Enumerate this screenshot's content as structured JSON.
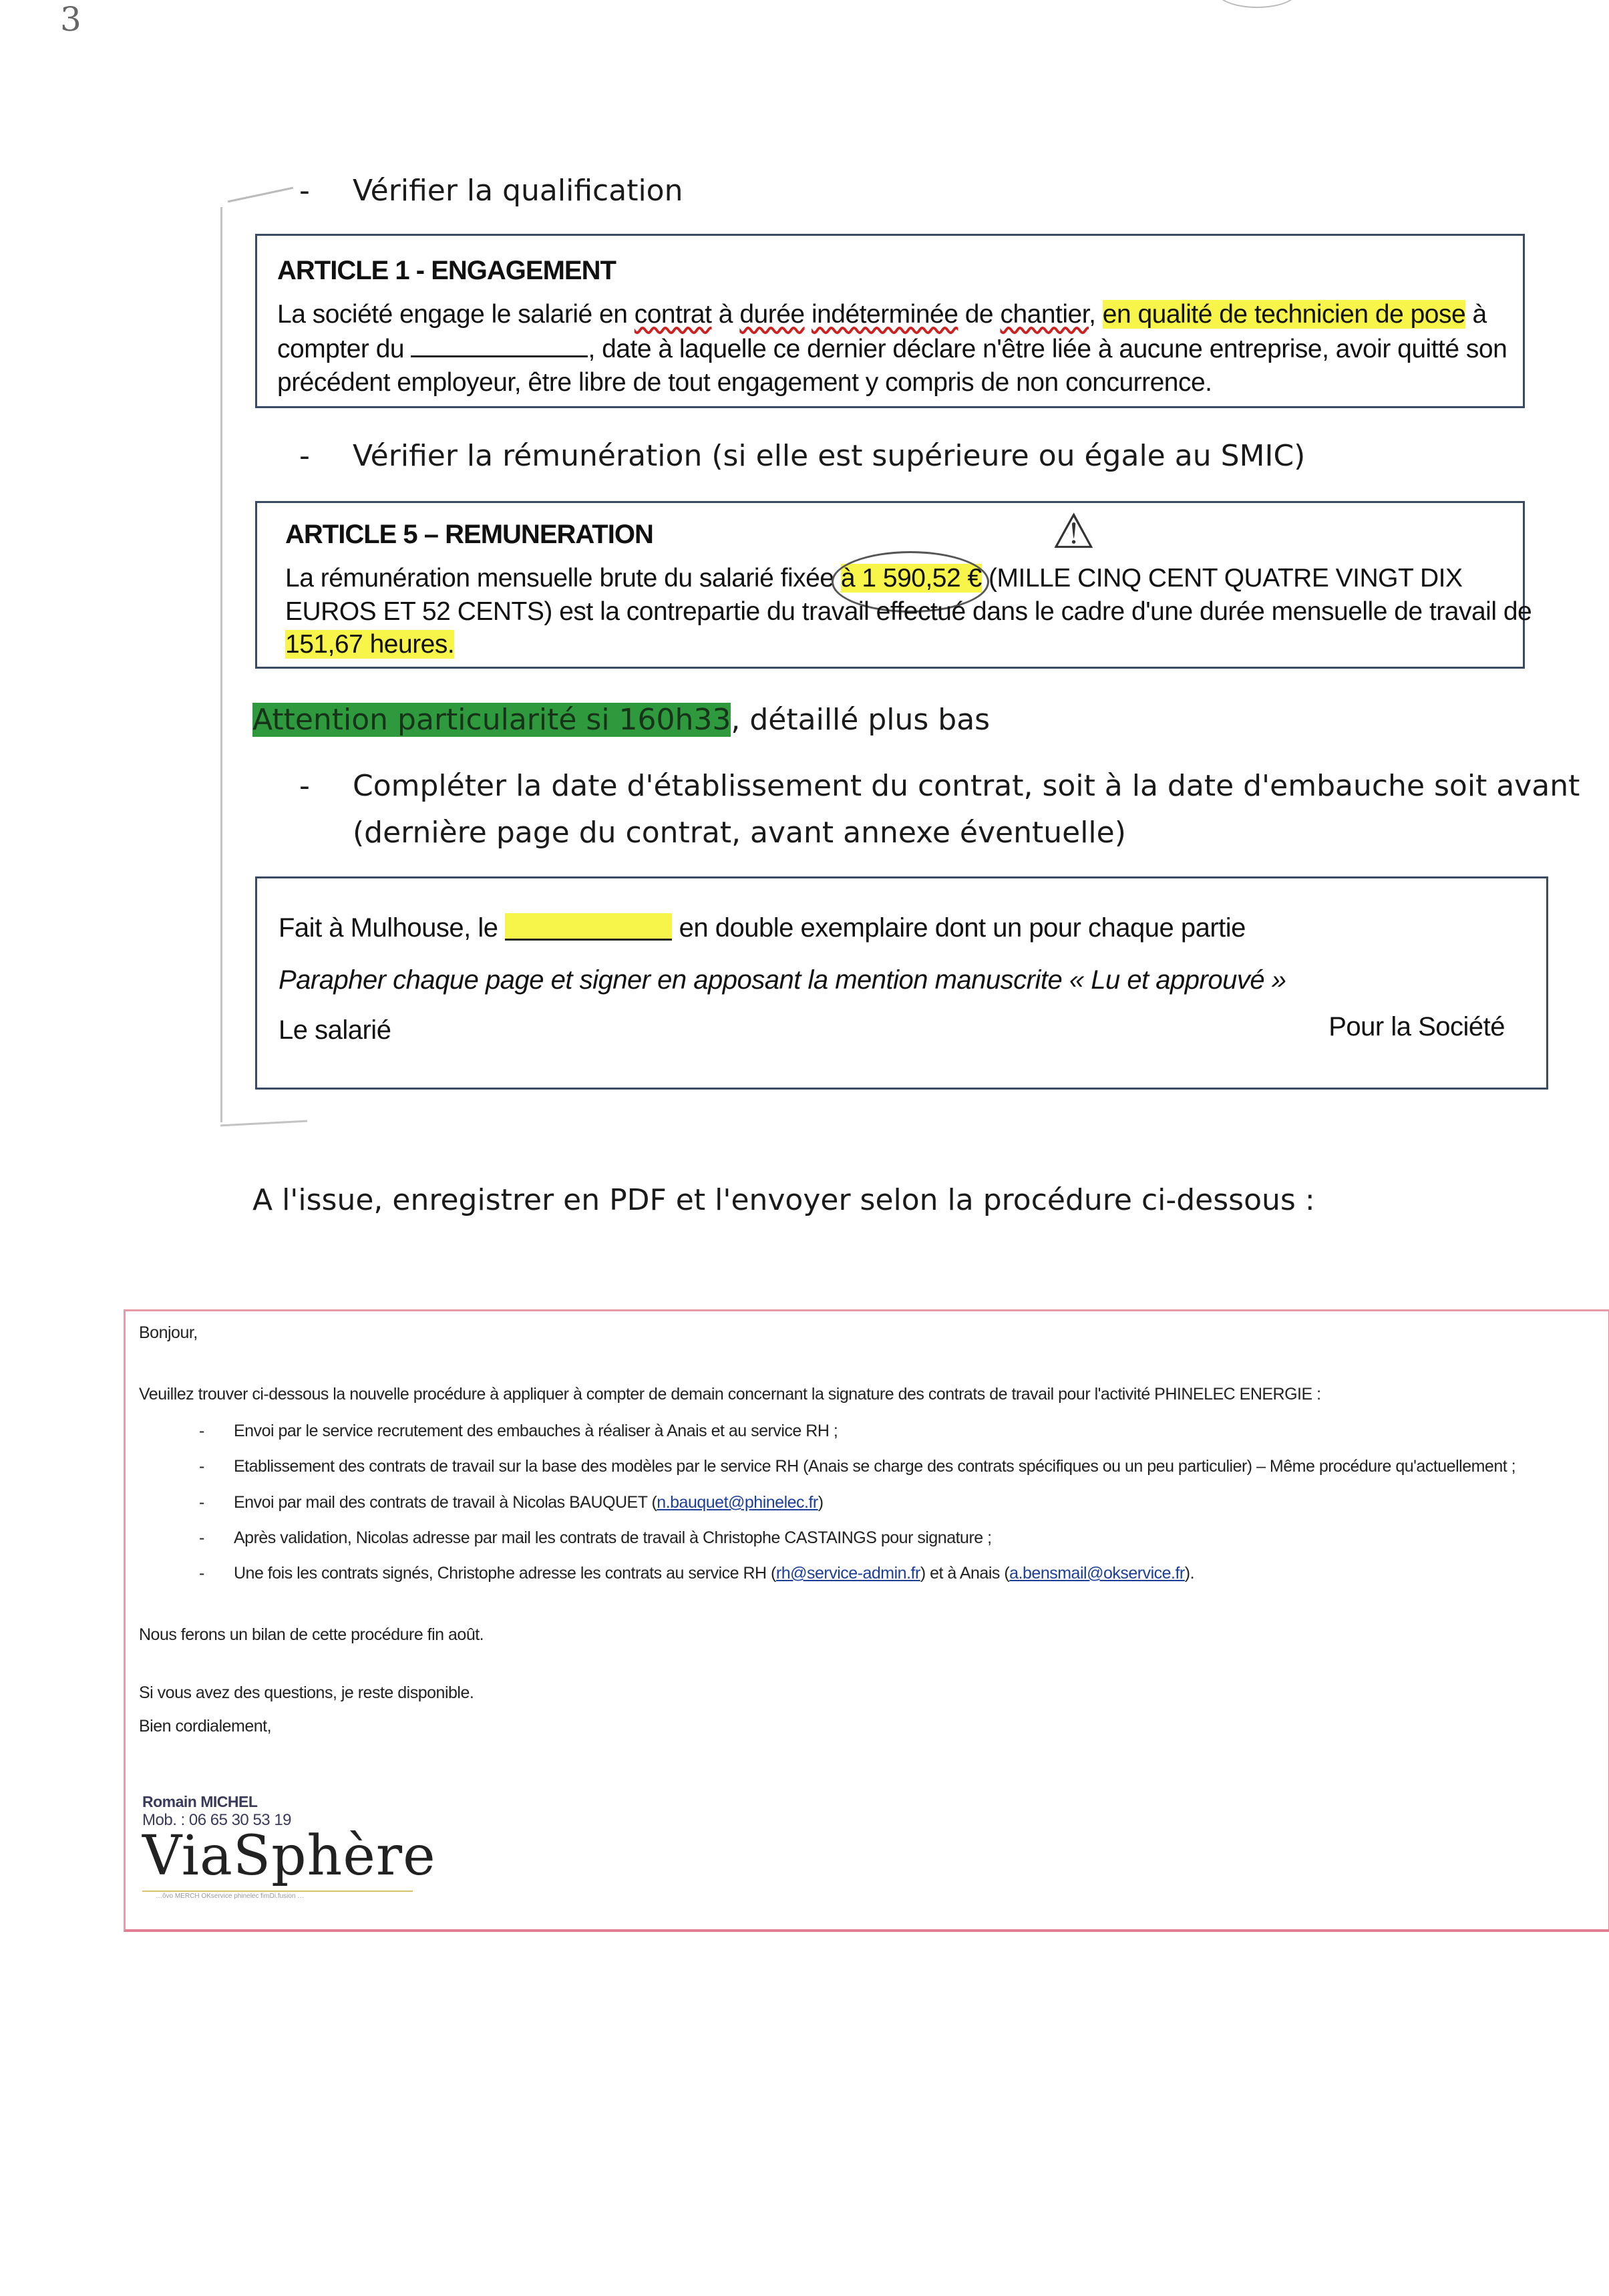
{
  "page_mark": "3",
  "bullet1": {
    "dash": "-",
    "text": "Vérifier la qualification"
  },
  "article1": {
    "title": "ARTICLE 1 - ENGAGEMENT",
    "l1_a": "La société engage le salarié en ",
    "l1_contrat": "contrat",
    "l1_b": " à ",
    "l1_duree": "durée",
    "l1_c": " ",
    "l1_indet": "indéterminée",
    "l1_d": " de ",
    "l1_chantier": "chantier",
    "l1_e": ", ",
    "l1_hl": "en qualité de technicien de pose",
    "l1_f": " à",
    "l2_a": "compter du ",
    "l2_b": ", date à laquelle ce dernier déclare n'être liée à aucune entreprise, avoir quitté son",
    "l3": "précédent employeur, être libre de tout engagement y compris de non concurrence."
  },
  "bullet2": {
    "dash": "-",
    "text": "Vérifier la rémunération (si elle est supérieure ou égale au SMIC)"
  },
  "article5": {
    "title": "ARTICLE 5 – REMUNERATION",
    "warning": "⚠",
    "l1_a": "La rémunération mensuelle brute du salarié fixée ",
    "l1_hl": "à 1 590,52 €",
    "l1_b": " (MILLE CINQ CENT QUATRE VINGT DIX",
    "l2": "EUROS ET 52 CENTS) est la contrepartie du travail effectué dans le cadre d'une durée mensuelle de travail de",
    "l3_hl": "151,67 heures."
  },
  "attention": {
    "hl": "Attention particularité si 160h33",
    "rest": ", détaillé plus bas"
  },
  "bullet3": {
    "dash": "-",
    "line1": "Compléter la date d'établissement du contrat, soit à la date d'embauche soit avant",
    "line2": "(dernière page du contrat, avant annexe éventuelle)"
  },
  "signature_box": {
    "l1_a": "Fait à Mulhouse, le ",
    "l1_b": " en double exemplaire dont un pour chaque partie",
    "l2": "Parapher chaque page et signer en apposant la mention manuscrite « Lu et approuvé »",
    "left": "Le salarié",
    "right": "Pour la Société"
  },
  "instruction": "A l'issue, enregistrer en PDF et l'envoyer selon la procédure ci-dessous :",
  "email": {
    "greeting": "Bonjour,",
    "intro": "Veuillez trouver ci-dessous la nouvelle procédure à appliquer à compter de demain concernant la signature des contrats de travail pour l'activité PHINELEC ENERGIE :",
    "items": [
      {
        "dash": "-",
        "text": "Envoi par le service recrutement des embauches à réaliser à Anais et au service RH ;"
      },
      {
        "dash": "-",
        "text": "Etablissement des contrats de travail sur la base des modèles par le service RH (Anais se charge des contrats spécifiques ou un peu particulier) – Même procédure qu'actuellement ;"
      },
      {
        "dash": "-",
        "text_a": "Envoi par mail des contrats de travail à Nicolas BAUQUET (",
        "link": "n.bauquet@phinelec.fr",
        "text_b": ")"
      },
      {
        "dash": "-",
        "text": "Après validation, Nicolas adresse par mail les contrats de travail à Christophe CASTAINGS pour signature ;"
      },
      {
        "dash": "-",
        "text_a": "Une fois les contrats signés, Christophe adresse les contrats au service RH (",
        "link1": "rh@service-admin.fr",
        "text_b": ") et à Anais (",
        "link2": "a.bensmail@okservice.fr",
        "text_c": ")."
      }
    ],
    "bilan": "Nous ferons un bilan de cette procédure fin août.",
    "questions": "Si vous avez des questions, je reste disponible.",
    "closing": "Bien cordialement,",
    "sender_name": "Romain MICHEL",
    "sender_mob": "Mob. : 06 65 30 53 19",
    "logo": "ViaSphère",
    "logo_tagline": "…ôvo MERCH OKservice phinelec fimDi.fusion …"
  }
}
